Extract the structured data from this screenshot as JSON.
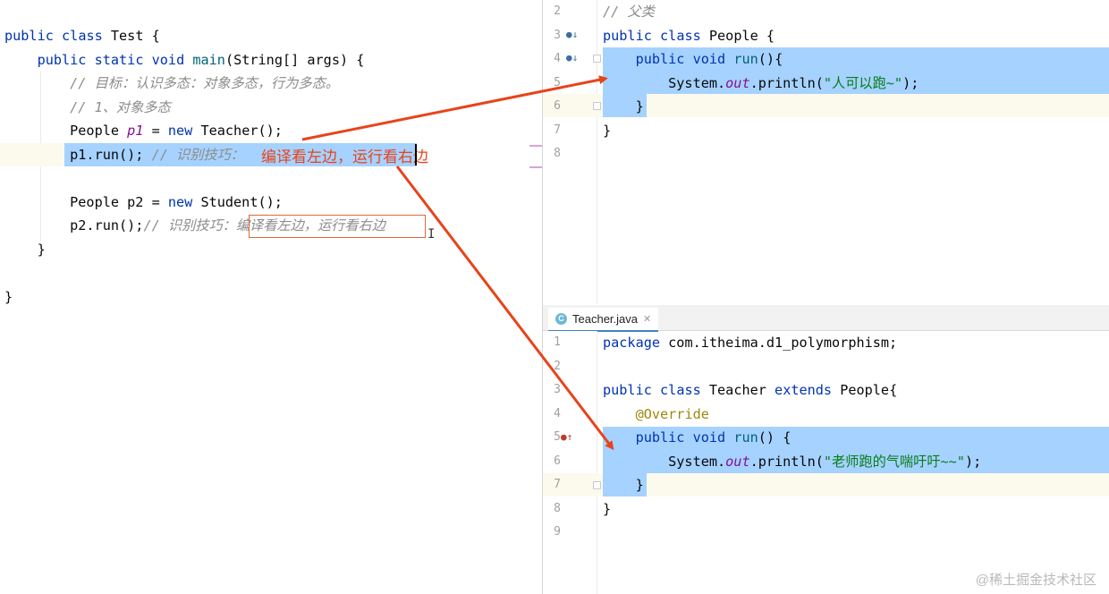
{
  "left_editor": {
    "lines": [
      {
        "parts": [
          [
            "kw",
            "public"
          ],
          [
            "var",
            " "
          ],
          [
            "kw",
            "class"
          ],
          [
            "var",
            " Test {"
          ]
        ]
      },
      {
        "parts": [
          [
            "var",
            "    "
          ],
          [
            "kw",
            "public"
          ],
          [
            "var",
            " "
          ],
          [
            "kw",
            "static"
          ],
          [
            "var",
            " "
          ],
          [
            "kw",
            "void"
          ],
          [
            "var",
            " "
          ],
          [
            "fn",
            "main"
          ],
          [
            "var",
            "(String[] args) {"
          ]
        ]
      },
      {
        "parts": [
          [
            "var",
            "        "
          ],
          [
            "cm",
            "// 目标：认识多态：对象多态，行为多态。"
          ]
        ]
      },
      {
        "parts": [
          [
            "var",
            "        "
          ],
          [
            "cm",
            "// 1、对象多态"
          ]
        ]
      },
      {
        "parts": [
          [
            "var",
            "        People "
          ],
          [
            "st",
            "p1"
          ],
          [
            "var",
            " = "
          ],
          [
            "kw",
            "new"
          ],
          [
            "var",
            " Teacher();"
          ]
        ]
      },
      {
        "parts": [
          [
            "var",
            "        p1.run(); "
          ],
          [
            "cm",
            "// 识别技巧："
          ]
        ]
      },
      {
        "parts": [
          [
            "var",
            ""
          ]
        ]
      },
      {
        "parts": [
          [
            "var",
            "        People p2 = "
          ],
          [
            "kw",
            "new"
          ],
          [
            "var",
            " Student();"
          ]
        ]
      },
      {
        "parts": [
          [
            "var",
            "        p2.run();"
          ],
          [
            "cm",
            "// 识别技巧：编译看左边，运行看右边"
          ]
        ]
      },
      {
        "parts": [
          [
            "var",
            "    }"
          ]
        ]
      },
      {
        "parts": [
          [
            "var",
            ""
          ]
        ]
      },
      {
        "parts": [
          [
            "var",
            "}"
          ]
        ]
      }
    ]
  },
  "callout_text": "编译看左边，运行看右边",
  "top_right_editor": {
    "lines": [
      {
        "num": "2",
        "parts": [
          [
            "cm",
            "// 父类"
          ]
        ]
      },
      {
        "num": "3",
        "parts": [
          [
            "kw",
            "public"
          ],
          [
            "var",
            " "
          ],
          [
            "kw",
            "class"
          ],
          [
            "var",
            " People {"
          ]
        ]
      },
      {
        "num": "4",
        "parts": [
          [
            "var",
            "    "
          ],
          [
            "kw",
            "public"
          ],
          [
            "var",
            " "
          ],
          [
            "kw",
            "void"
          ],
          [
            "var",
            " "
          ],
          [
            "fn",
            "run"
          ],
          [
            "var",
            "(){"
          ]
        ]
      },
      {
        "num": "5",
        "parts": [
          [
            "var",
            "        System."
          ],
          [
            "st",
            "out"
          ],
          [
            "var",
            ".println("
          ],
          [
            "str",
            "\"人可以跑~\""
          ],
          [
            "var",
            ");"
          ]
        ]
      },
      {
        "num": "6",
        "parts": [
          [
            "var",
            "    }"
          ]
        ]
      },
      {
        "num": "7",
        "parts": [
          [
            "var",
            "}"
          ]
        ]
      },
      {
        "num": "8",
        "parts": [
          [
            "var",
            ""
          ]
        ]
      }
    ]
  },
  "bottom_right_editor": {
    "tab_label": "Teacher.java",
    "lines": [
      {
        "num": "1",
        "parts": [
          [
            "kw",
            "package"
          ],
          [
            "var",
            " com.itheima.d1_polymorphism;"
          ]
        ]
      },
      {
        "num": "2",
        "parts": [
          [
            "var",
            ""
          ]
        ]
      },
      {
        "num": "3",
        "parts": [
          [
            "kw",
            "public"
          ],
          [
            "var",
            " "
          ],
          [
            "kw",
            "class"
          ],
          [
            "var",
            " Teacher "
          ],
          [
            "kw",
            "extends"
          ],
          [
            "var",
            " People{"
          ]
        ]
      },
      {
        "num": "4",
        "parts": [
          [
            "var",
            "    "
          ],
          [
            "ann",
            "@Override"
          ]
        ]
      },
      {
        "num": "5",
        "parts": [
          [
            "var",
            "    "
          ],
          [
            "kw",
            "public"
          ],
          [
            "var",
            " "
          ],
          [
            "kw",
            "void"
          ],
          [
            "var",
            " "
          ],
          [
            "fn",
            "run"
          ],
          [
            "var",
            "() {"
          ]
        ]
      },
      {
        "num": "6",
        "parts": [
          [
            "var",
            "        System."
          ],
          [
            "st",
            "out"
          ],
          [
            "var",
            ".println("
          ],
          [
            "str",
            "\"老师跑的气喘吁吁~~\""
          ],
          [
            "var",
            ");"
          ]
        ]
      },
      {
        "num": "7",
        "parts": [
          [
            "var",
            "    }"
          ]
        ]
      },
      {
        "num": "8",
        "parts": [
          [
            "var",
            "}"
          ]
        ]
      },
      {
        "num": "9",
        "parts": [
          [
            "var",
            ""
          ]
        ]
      }
    ]
  },
  "watermark": "@稀土掘金技术社区",
  "colors": {
    "arrow": "#e8431a",
    "selection": "#a6d2ff",
    "keyword": "#0033b3",
    "comment": "#8c8c8c",
    "string": "#067d17"
  }
}
